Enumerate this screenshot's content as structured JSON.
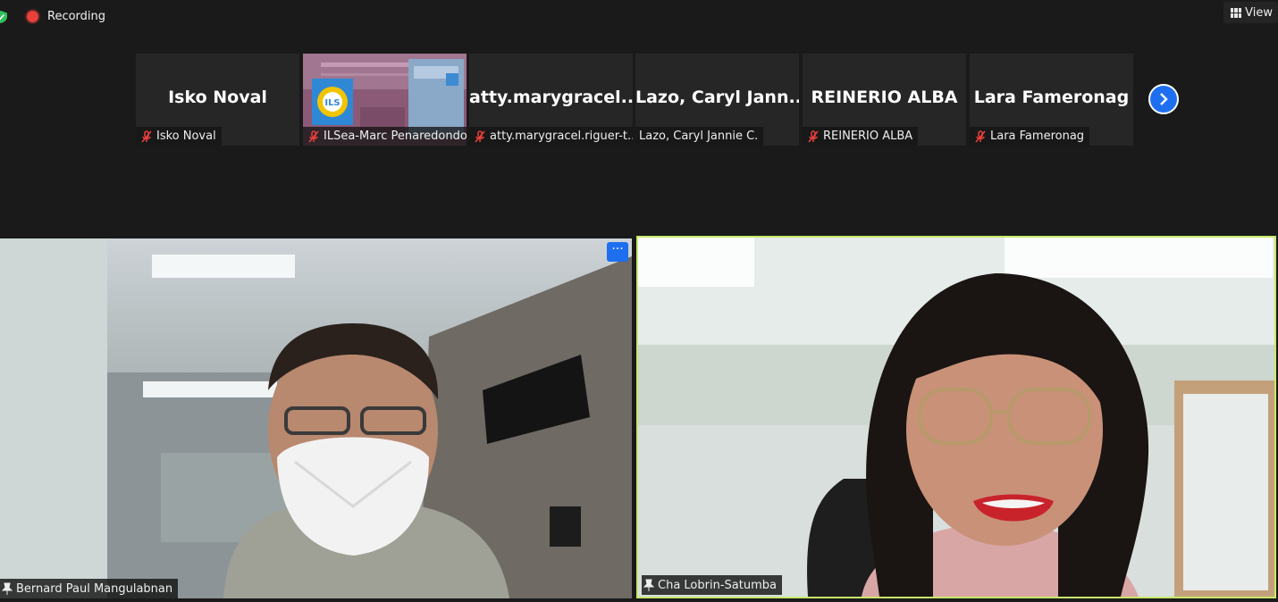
{
  "topbar": {
    "recording_label": "Recording",
    "view_label": "View"
  },
  "strip": {
    "tiles": [
      {
        "display_name": "Isko Noval",
        "label": "Isko Noval",
        "muted": true,
        "has_video": false
      },
      {
        "display_name": "",
        "label": "ILSea-Marc Penaredondo",
        "muted": true,
        "has_video": true
      },
      {
        "display_name": "atty.marygracel....",
        "label": "atty.marygracel.riguer-t...",
        "muted": true,
        "has_video": false
      },
      {
        "display_name": "Lazo, Caryl Jann...",
        "label": "Lazo, Caryl Jannie C.",
        "muted": false,
        "has_video": false
      },
      {
        "display_name": "REINERIO ALBA",
        "label": "REINERIO ALBA",
        "muted": true,
        "has_video": false
      },
      {
        "display_name": "Lara Fameronag",
        "label": "Lara Fameronag",
        "muted": true,
        "has_video": false
      }
    ]
  },
  "main": {
    "left": {
      "name": "Bernard Paul Mangulabnan",
      "more_label": "···"
    },
    "right": {
      "name": "Cha Lobrin-Satumba"
    }
  },
  "colors": {
    "accent": "#1e6ff0",
    "active_speaker_border": "#c7e86a",
    "recording": "#e8403b",
    "muted_icon": "#e8403b"
  }
}
